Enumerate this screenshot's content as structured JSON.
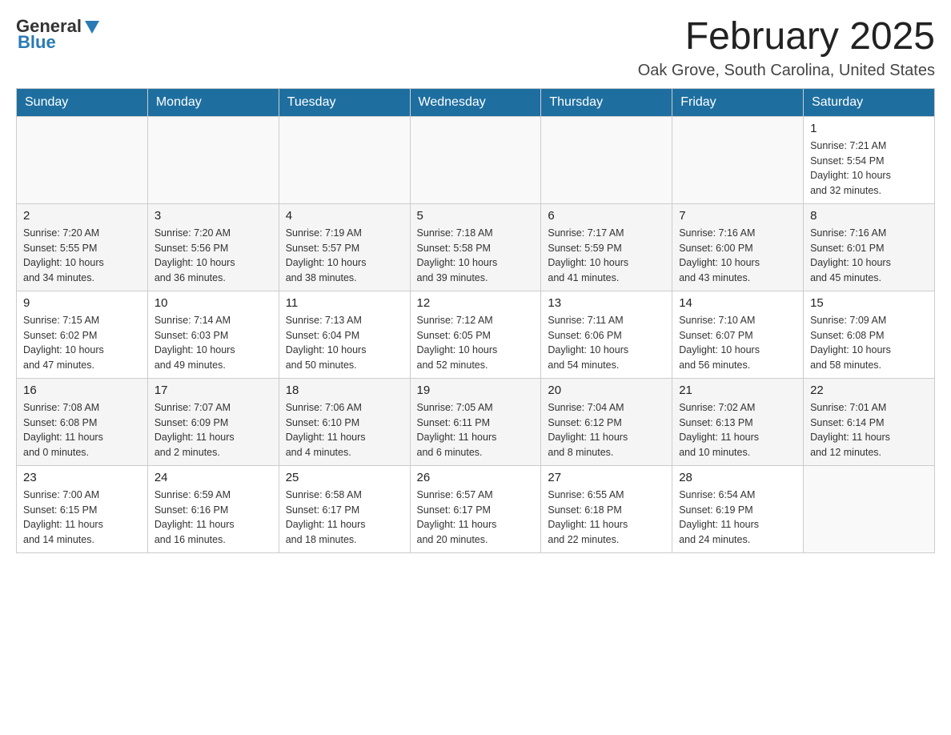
{
  "header": {
    "logo_general": "General",
    "logo_blue": "Blue",
    "month_title": "February 2025",
    "location": "Oak Grove, South Carolina, United States"
  },
  "weekdays": [
    "Sunday",
    "Monday",
    "Tuesday",
    "Wednesday",
    "Thursday",
    "Friday",
    "Saturday"
  ],
  "weeks": [
    [
      {
        "day": "",
        "info": ""
      },
      {
        "day": "",
        "info": ""
      },
      {
        "day": "",
        "info": ""
      },
      {
        "day": "",
        "info": ""
      },
      {
        "day": "",
        "info": ""
      },
      {
        "day": "",
        "info": ""
      },
      {
        "day": "1",
        "info": "Sunrise: 7:21 AM\nSunset: 5:54 PM\nDaylight: 10 hours\nand 32 minutes."
      }
    ],
    [
      {
        "day": "2",
        "info": "Sunrise: 7:20 AM\nSunset: 5:55 PM\nDaylight: 10 hours\nand 34 minutes."
      },
      {
        "day": "3",
        "info": "Sunrise: 7:20 AM\nSunset: 5:56 PM\nDaylight: 10 hours\nand 36 minutes."
      },
      {
        "day": "4",
        "info": "Sunrise: 7:19 AM\nSunset: 5:57 PM\nDaylight: 10 hours\nand 38 minutes."
      },
      {
        "day": "5",
        "info": "Sunrise: 7:18 AM\nSunset: 5:58 PM\nDaylight: 10 hours\nand 39 minutes."
      },
      {
        "day": "6",
        "info": "Sunrise: 7:17 AM\nSunset: 5:59 PM\nDaylight: 10 hours\nand 41 minutes."
      },
      {
        "day": "7",
        "info": "Sunrise: 7:16 AM\nSunset: 6:00 PM\nDaylight: 10 hours\nand 43 minutes."
      },
      {
        "day": "8",
        "info": "Sunrise: 7:16 AM\nSunset: 6:01 PM\nDaylight: 10 hours\nand 45 minutes."
      }
    ],
    [
      {
        "day": "9",
        "info": "Sunrise: 7:15 AM\nSunset: 6:02 PM\nDaylight: 10 hours\nand 47 minutes."
      },
      {
        "day": "10",
        "info": "Sunrise: 7:14 AM\nSunset: 6:03 PM\nDaylight: 10 hours\nand 49 minutes."
      },
      {
        "day": "11",
        "info": "Sunrise: 7:13 AM\nSunset: 6:04 PM\nDaylight: 10 hours\nand 50 minutes."
      },
      {
        "day": "12",
        "info": "Sunrise: 7:12 AM\nSunset: 6:05 PM\nDaylight: 10 hours\nand 52 minutes."
      },
      {
        "day": "13",
        "info": "Sunrise: 7:11 AM\nSunset: 6:06 PM\nDaylight: 10 hours\nand 54 minutes."
      },
      {
        "day": "14",
        "info": "Sunrise: 7:10 AM\nSunset: 6:07 PM\nDaylight: 10 hours\nand 56 minutes."
      },
      {
        "day": "15",
        "info": "Sunrise: 7:09 AM\nSunset: 6:08 PM\nDaylight: 10 hours\nand 58 minutes."
      }
    ],
    [
      {
        "day": "16",
        "info": "Sunrise: 7:08 AM\nSunset: 6:08 PM\nDaylight: 11 hours\nand 0 minutes."
      },
      {
        "day": "17",
        "info": "Sunrise: 7:07 AM\nSunset: 6:09 PM\nDaylight: 11 hours\nand 2 minutes."
      },
      {
        "day": "18",
        "info": "Sunrise: 7:06 AM\nSunset: 6:10 PM\nDaylight: 11 hours\nand 4 minutes."
      },
      {
        "day": "19",
        "info": "Sunrise: 7:05 AM\nSunset: 6:11 PM\nDaylight: 11 hours\nand 6 minutes."
      },
      {
        "day": "20",
        "info": "Sunrise: 7:04 AM\nSunset: 6:12 PM\nDaylight: 11 hours\nand 8 minutes."
      },
      {
        "day": "21",
        "info": "Sunrise: 7:02 AM\nSunset: 6:13 PM\nDaylight: 11 hours\nand 10 minutes."
      },
      {
        "day": "22",
        "info": "Sunrise: 7:01 AM\nSunset: 6:14 PM\nDaylight: 11 hours\nand 12 minutes."
      }
    ],
    [
      {
        "day": "23",
        "info": "Sunrise: 7:00 AM\nSunset: 6:15 PM\nDaylight: 11 hours\nand 14 minutes."
      },
      {
        "day": "24",
        "info": "Sunrise: 6:59 AM\nSunset: 6:16 PM\nDaylight: 11 hours\nand 16 minutes."
      },
      {
        "day": "25",
        "info": "Sunrise: 6:58 AM\nSunset: 6:17 PM\nDaylight: 11 hours\nand 18 minutes."
      },
      {
        "day": "26",
        "info": "Sunrise: 6:57 AM\nSunset: 6:17 PM\nDaylight: 11 hours\nand 20 minutes."
      },
      {
        "day": "27",
        "info": "Sunrise: 6:55 AM\nSunset: 6:18 PM\nDaylight: 11 hours\nand 22 minutes."
      },
      {
        "day": "28",
        "info": "Sunrise: 6:54 AM\nSunset: 6:19 PM\nDaylight: 11 hours\nand 24 minutes."
      },
      {
        "day": "",
        "info": ""
      }
    ]
  ]
}
